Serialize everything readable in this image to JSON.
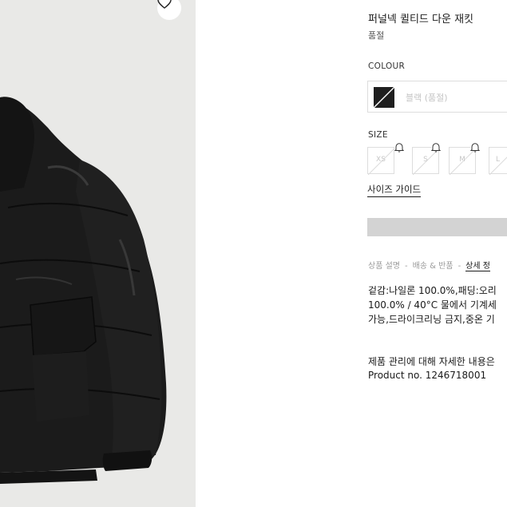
{
  "product": {
    "title": "퍼널넥 퀼티드 다운 재킷",
    "status": "품절",
    "colour_label": "COLOUR",
    "colour_value": "블랙 (품절)",
    "size_label": "SIZE",
    "sizes": [
      "XS",
      "S",
      "M",
      "L"
    ],
    "size_guide": "사이즈 가이드",
    "tabs": [
      "상품 설명",
      "배송 & 반품",
      "상세 정"
    ],
    "description": [
      "겉감:나일론 100.0%,패딩:오리",
      "100.0% / 40°C 물에서 기계세",
      "가능,드라이크리닝 금지,중온 기"
    ],
    "care_note": "제품 관리에 대해 자세한 내용은",
    "product_no": "Product no. 1246718001"
  },
  "icons": {
    "favorite": "heart-icon",
    "notify": "bell-icon",
    "colour_swatch": "black-swatch-crossed"
  },
  "colors": {
    "swatch": "#1f1f1f",
    "disabled_button": "#d3d3d3",
    "photo_bg": "#e9e9e7"
  }
}
